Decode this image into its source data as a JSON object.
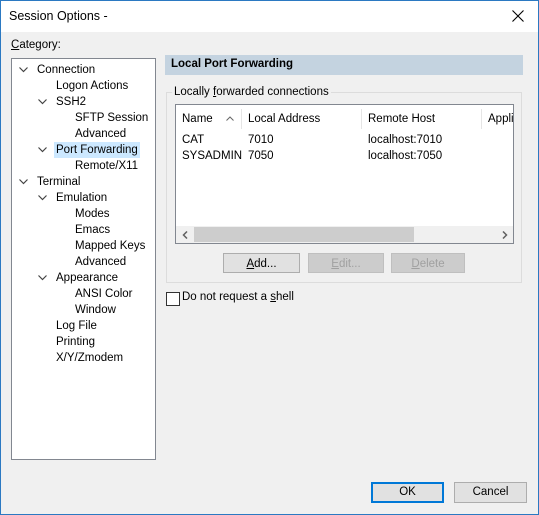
{
  "window": {
    "title": "Session Options -",
    "close_icon": "close-icon"
  },
  "category": {
    "label_underline": "C",
    "label_rest": "ategory:",
    "tree": [
      {
        "label": "Connection",
        "expanded": true,
        "selected": false
      },
      {
        "label": "Logon Actions",
        "selected": false
      },
      {
        "label": "SSH2",
        "expanded": true,
        "selected": false
      },
      {
        "label": "SFTP Session",
        "selected": false
      },
      {
        "label": "Advanced",
        "selected": false
      },
      {
        "label": "Port Forwarding",
        "expanded": true,
        "selected": true
      },
      {
        "label": "Remote/X11",
        "selected": false
      },
      {
        "label": "Terminal",
        "expanded": true,
        "selected": false
      },
      {
        "label": "Emulation",
        "expanded": true,
        "selected": false
      },
      {
        "label": "Modes",
        "selected": false
      },
      {
        "label": "Emacs",
        "selected": false
      },
      {
        "label": "Mapped Keys",
        "selected": false
      },
      {
        "label": "Advanced",
        "selected": false
      },
      {
        "label": "Appearance",
        "expanded": true,
        "selected": false
      },
      {
        "label": "ANSI Color",
        "selected": false
      },
      {
        "label": "Window",
        "selected": false
      },
      {
        "label": "Log File",
        "selected": false
      },
      {
        "label": "Printing",
        "selected": false
      },
      {
        "label": "X/Y/Zmodem",
        "selected": false
      }
    ]
  },
  "panel": {
    "header": "Local Port Forwarding",
    "group": {
      "label_pre": "Locally ",
      "label_underline": "f",
      "label_post": "orwarded connections"
    },
    "list": {
      "columns": [
        "Name",
        "Local Address",
        "Remote Host",
        "Appli"
      ],
      "sort_column": "Name",
      "rows": [
        {
          "name": "CAT",
          "local": "7010",
          "remote": "localhost:7010"
        },
        {
          "name": "SYSADMIN",
          "local": "7050",
          "remote": "localhost:7050"
        }
      ]
    },
    "buttons": {
      "add": {
        "u": "A",
        "rest": "dd..."
      },
      "edit": {
        "u": "E",
        "rest": "dit..."
      },
      "delete": {
        "u": "D",
        "rest": "elete"
      }
    },
    "checkbox": {
      "pre": "Do not request a ",
      "u": "s",
      "post": "hell",
      "checked": false
    }
  },
  "footer": {
    "ok": "OK",
    "cancel": "Cancel"
  }
}
